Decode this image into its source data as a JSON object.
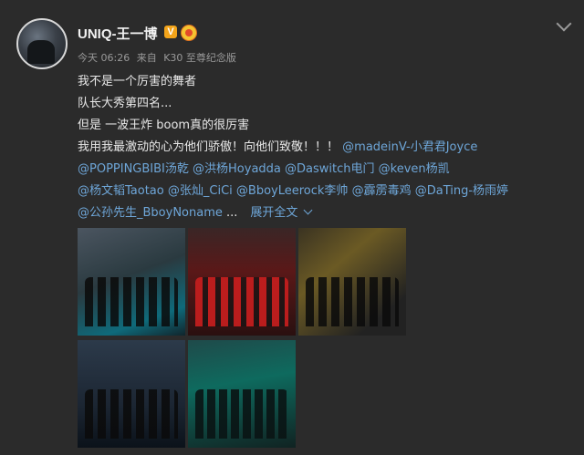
{
  "post": {
    "username": "UNIQ-王一博",
    "verified_badge": "V",
    "badges": [
      "verified-icon",
      "rank-badge-icon"
    ],
    "time": "今天 06:26",
    "via": "来自",
    "device": "K30 至尊纪念版"
  },
  "lines": {
    "l1": "我不是一个厉害的舞者",
    "l2": "队长大秀第四名...",
    "l3": "但是 一波王炸 boom真的很厉害",
    "l4_text": "我用我最激动的心为他们骄傲！向他们致敬！！！",
    "l4_mention": "@madeinV-小君君Joyce",
    "l5_m1": "@POPPINGBIBI汤乾",
    "l5_m2": "@洪杨Hoyadda",
    "l5_m3": "@Daswitch电门",
    "l5_m4": "@keven杨凯",
    "l6_m1": "@杨文韬Taotao",
    "l6_m2": "@张灿_CiCi",
    "l6_m3": "@BboyLeerock李帅",
    "l6_m4": "@霹雳毒鸡",
    "l6_m5": "@DaTing-杨雨婷",
    "l7_m1": "@公孙先生_BboyNoname",
    "l7_ellipsis": "...",
    "expand_label": "展开全文"
  },
  "photos": [
    {
      "name": "photo-1"
    },
    {
      "name": "photo-2"
    },
    {
      "name": "photo-3"
    },
    {
      "name": "photo-4"
    },
    {
      "name": "photo-5"
    }
  ],
  "colors": {
    "background": "#2b2b2b",
    "mention": "#6ea6d8",
    "meta": "#9a9a9a"
  }
}
